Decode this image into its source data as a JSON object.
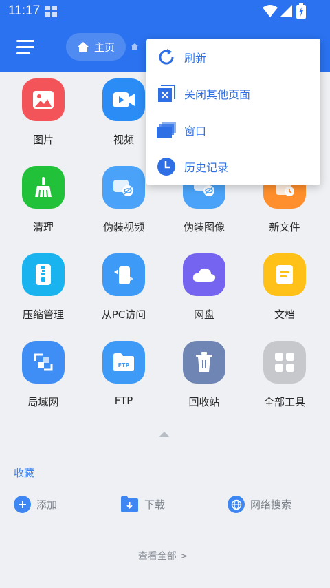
{
  "status_bar": {
    "time": "11:17"
  },
  "header": {
    "home_label": "主页"
  },
  "grid": [
    {
      "label": "图片",
      "color": "#f2545a"
    },
    {
      "label": "视频",
      "color": "#2b8cf5"
    },
    {
      "label": "",
      "color": "#3d8ef5"
    },
    {
      "label": "",
      "color": "#ff8f2c"
    },
    {
      "label": "清理",
      "color": "#22c13a"
    },
    {
      "label": "伪装视频",
      "color": "#4aa3f8"
    },
    {
      "label": "伪装图像",
      "color": "#4aa3f8"
    },
    {
      "label": "新文件",
      "color": "#ff8f2c"
    },
    {
      "label": "压缩管理",
      "color": "#19b4f0"
    },
    {
      "label": "从PC访问",
      "color": "#3d9af6"
    },
    {
      "label": "网盘",
      "color": "#7564f0"
    },
    {
      "label": "文档",
      "color": "#ffc117"
    },
    {
      "label": "局域网",
      "color": "#3e8ef5"
    },
    {
      "label": "FTP",
      "color": "#3d9af6"
    },
    {
      "label": "回收站",
      "color": "#6f86b5"
    },
    {
      "label": "全部工具",
      "color": "#c6c8cc"
    }
  ],
  "favorites": {
    "title": "收藏",
    "items": [
      {
        "label": "添加",
        "icon": "plus-icon"
      },
      {
        "label": "下载",
        "icon": "download-folder-icon"
      },
      {
        "label": "网络搜索",
        "icon": "globe-icon"
      }
    ],
    "view_all": "查看全部 >"
  },
  "popup_menu": {
    "items": [
      {
        "label": "刷新",
        "icon": "refresh-icon"
      },
      {
        "label": "关闭其他页面",
        "icon": "close-box-icon"
      },
      {
        "label": "窗口",
        "icon": "windows-icon"
      },
      {
        "label": "历史记录",
        "icon": "clock-icon"
      }
    ]
  },
  "colors": {
    "accent": "#2a72f0",
    "background": "#eef0f3"
  }
}
